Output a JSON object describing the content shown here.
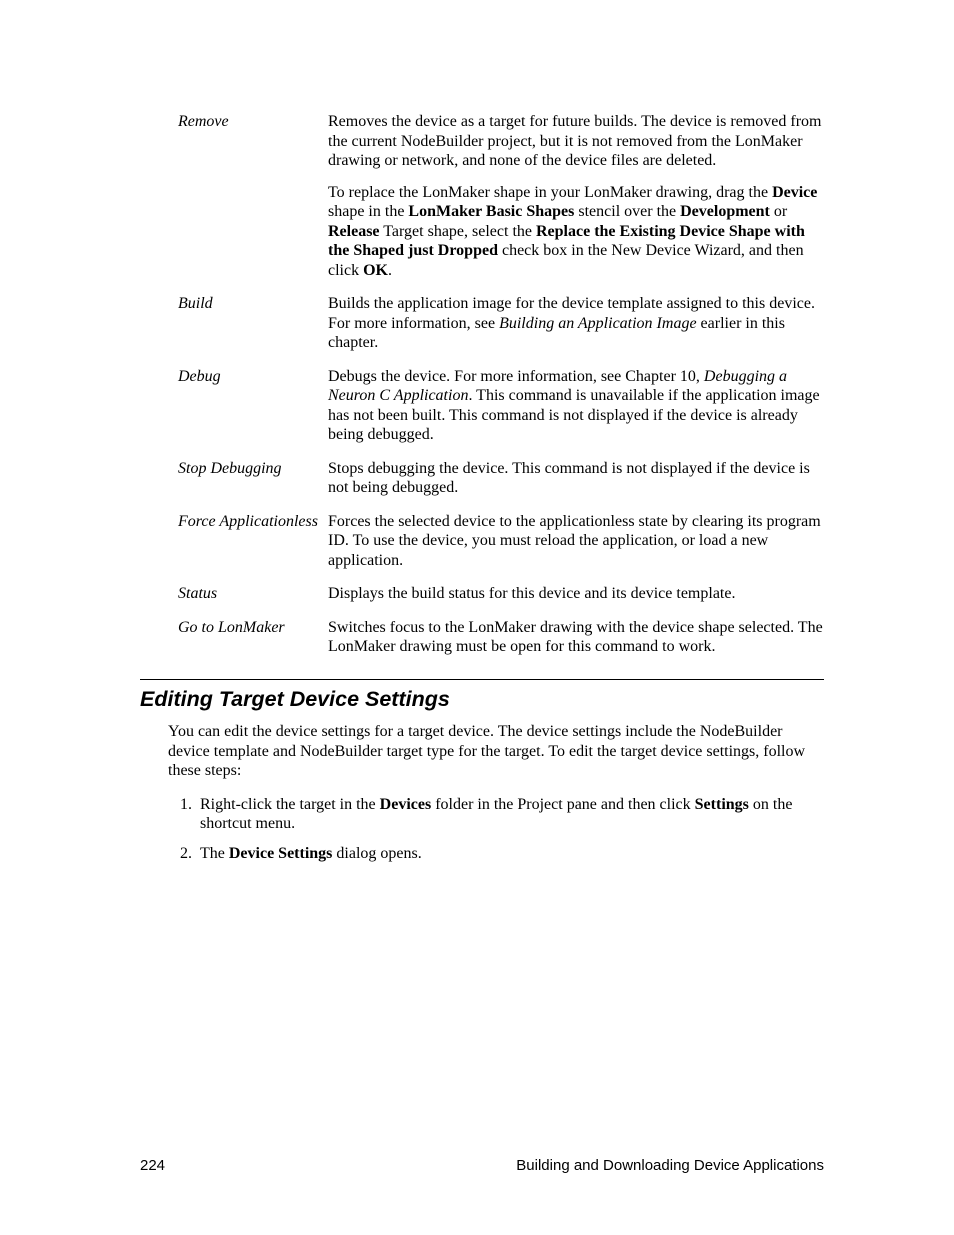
{
  "rows": [
    {
      "term": "Remove",
      "paragraphs": [
        [
          {
            "t": "Removes the device as a target for future builds.  The device is removed from the current NodeBuilder project, but it is not removed from the LonMaker drawing or network, and none of the device files are deleted."
          }
        ],
        [
          {
            "t": "To replace the LonMaker shape in your LonMaker drawing, drag the "
          },
          {
            "t": "Device",
            "b": true
          },
          {
            "t": " shape in the "
          },
          {
            "t": "LonMaker Basic Shapes",
            "b": true
          },
          {
            "t": " stencil over the "
          },
          {
            "t": "Development",
            "b": true
          },
          {
            "t": " or "
          },
          {
            "t": "Release",
            "b": true
          },
          {
            "t": " Target shape, select the "
          },
          {
            "t": "Replace the Existing Device Shape with the Shaped just Dropped",
            "b": true
          },
          {
            "t": " check box in the New Device Wizard, and then click "
          },
          {
            "t": "OK",
            "b": true
          },
          {
            "t": "."
          }
        ]
      ]
    },
    {
      "term": "Build",
      "paragraphs": [
        [
          {
            "t": "Builds the application image for the device template assigned to this device.  For more information, see "
          },
          {
            "t": "Building an Application Image",
            "i": true
          },
          {
            "t": " earlier in this chapter."
          }
        ]
      ]
    },
    {
      "term": "Debug",
      "paragraphs": [
        [
          {
            "t": "Debugs the device.  For more information, see Chapter 10, "
          },
          {
            "t": "Debugging a Neuron C Application",
            "i": true
          },
          {
            "t": ".  This command is unavailable if the application image has not been built.  This command is not displayed if the device is already being debugged."
          }
        ]
      ]
    },
    {
      "term": "Stop Debugging",
      "paragraphs": [
        [
          {
            "t": "Stops debugging the device.  This command is not displayed if the device is not being debugged."
          }
        ]
      ]
    },
    {
      "term": "Force Applicationless",
      "paragraphs": [
        [
          {
            "t": "Forces the selected device to the applicationless state by clearing its program ID.  To use the device, you must reload the application, or load a new application."
          }
        ]
      ]
    },
    {
      "term": "Status",
      "paragraphs": [
        [
          {
            "t": "Displays the build status for this device and its device template."
          }
        ]
      ]
    },
    {
      "term": "Go to LonMaker",
      "paragraphs": [
        [
          {
            "t": "Switches focus to the LonMaker drawing with the device shape selected.  The LonMaker drawing must be open for this command to work."
          }
        ]
      ]
    }
  ],
  "section_heading": "Editing Target Device Settings",
  "intro_para": "You can edit the device settings for a target device.  The device settings include the NodeBuilder device template and NodeBuilder target type for the target.  To edit the target device settings, follow these steps:",
  "steps": [
    [
      {
        "t": "Right-click the target in the "
      },
      {
        "t": "Devices",
        "b": true
      },
      {
        "t": " folder in the Project pane and then click "
      },
      {
        "t": "Settings",
        "b": true
      },
      {
        "t": " on the shortcut menu."
      }
    ],
    [
      {
        "t": "The "
      },
      {
        "t": "Device Settings",
        "b": true
      },
      {
        "t": " dialog opens."
      }
    ]
  ],
  "footer": {
    "page_num": "224",
    "title": "Building and Downloading Device Applications"
  }
}
